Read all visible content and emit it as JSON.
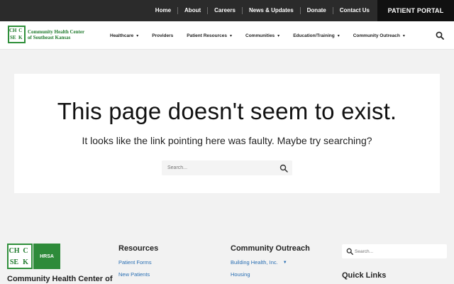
{
  "topbar": {
    "links": [
      "Home",
      "About",
      "Careers",
      "News & Updates",
      "Donate",
      "Contact Us"
    ],
    "portal": "PATIENT PORTAL"
  },
  "header": {
    "logo_letters": [
      "CH",
      "C",
      "SE",
      "K"
    ],
    "logo_line1": "Community Health Center",
    "logo_line2": "of Southeast Kansas",
    "nav": [
      {
        "label": "Healthcare",
        "dropdown": true
      },
      {
        "label": "Providers",
        "dropdown": false
      },
      {
        "label": "Patient Resources",
        "dropdown": true
      },
      {
        "label": "Communities",
        "dropdown": true
      },
      {
        "label": "Education/Training",
        "dropdown": true
      },
      {
        "label": "Community Outreach",
        "dropdown": true
      }
    ]
  },
  "main": {
    "headline": "This page doesn't seem to exist.",
    "subtext": "It looks like the link pointing here was faulty. Maybe try searching?",
    "search_placeholder": "Search..."
  },
  "footer": {
    "hrsa_label": "HRSA",
    "org_name": "Community Health Center of",
    "resources": {
      "title": "Resources",
      "links": [
        "Patient Forms",
        "New Patients"
      ]
    },
    "outreach": {
      "title": "Community Outreach",
      "links": [
        {
          "label": "Building Health, Inc.",
          "dropdown": true
        },
        {
          "label": "Housing",
          "dropdown": false
        }
      ]
    },
    "search_placeholder": "Search...",
    "quick_links_title": "Quick Links"
  },
  "colors": {
    "topbar_bg": "#2b2b2b",
    "portal_bg": "#111111",
    "brand_green": "#1f7a2c",
    "link_blue": "#2a6fb3"
  }
}
